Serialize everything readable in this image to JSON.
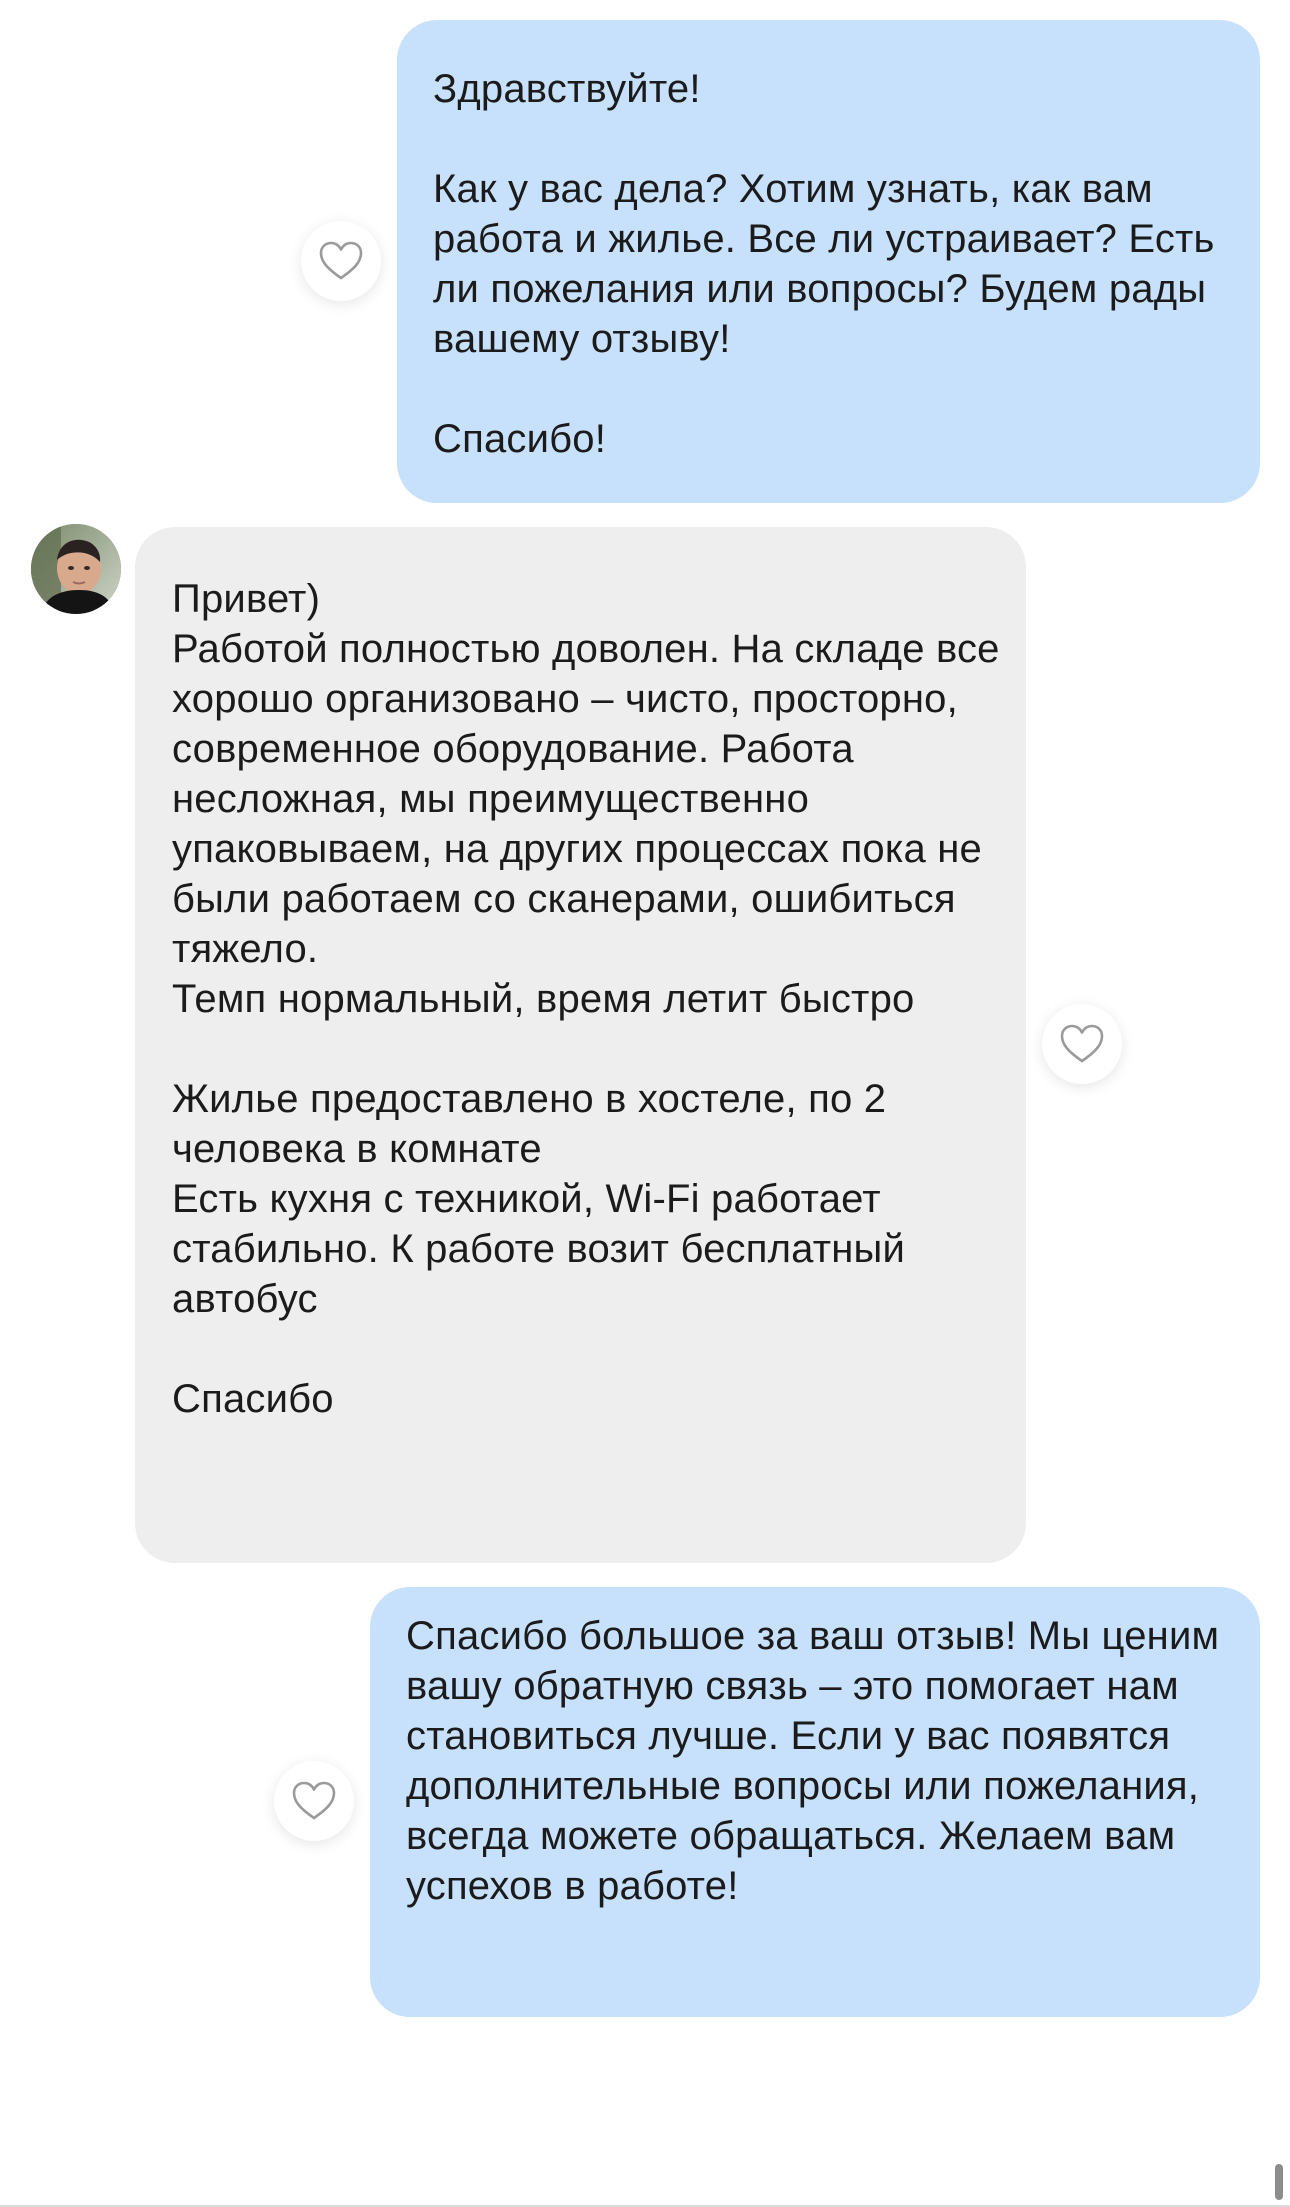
{
  "messages": [
    {
      "sender": "outgoing",
      "text": "Здравствуйте!\n\nКак у вас дела? Хотим узнать, как вам работа и жилье. Все ли устраивает? Есть ли пожелания или вопросы? Будем рады вашему отзыву!\n\nСпасибо!"
    },
    {
      "sender": "incoming",
      "text": "Привет)\nРаботой полностью доволен. На складе все хорошо организовано – чисто, просторно, современное оборудование. Работа несложная, мы преимущественно упаковываем, на других процессах пока не были работаем со сканерами, ошибиться тяжело.\nТемп нормальный, время летит быстро\n\nЖилье предоставлено в хостеле, по 2 человека в комнате\nЕсть кухня с техникой, Wi-Fi работает стабильно. К работе возит бесплатный автобус\n\nСпасибо"
    },
    {
      "sender": "outgoing",
      "text": "Спасибо большое за ваш отзыв! Мы ценим вашу обратную связь – это помогает нам становиться лучше. Если у вас появятся дополнительные вопросы или пожелания, всегда можете обращаться. Желаем вам успехов в работе!"
    }
  ],
  "icons": {
    "like": "heart-outline-icon",
    "avatar": "user-avatar-photo"
  },
  "colors": {
    "outgoing_bubble": "#c7e0fb",
    "incoming_bubble": "#eeeeee",
    "text": "#1b1b1b",
    "heart_stroke": "#9a9a9a"
  }
}
